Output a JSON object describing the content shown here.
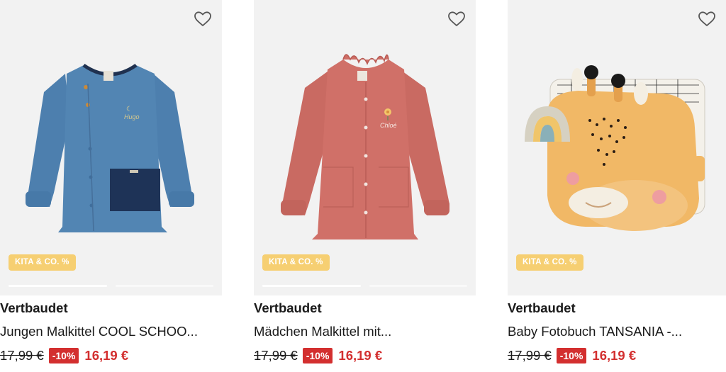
{
  "colors": {
    "badge": "#f6cf72",
    "discount": "#d32f2f",
    "price_new": "#d32f2f",
    "image_bg": "#f2f2f2"
  },
  "products": [
    {
      "badge": "KITA & CO. %",
      "brand": "Vertbaudet",
      "title": "Jungen Malkittel COOL SCHOO...",
      "price_old": "17,99 €",
      "discount": "-10%",
      "price_new": "16,19 €",
      "embroidery": "Hugo",
      "icon": "heart-outline-icon",
      "image_count": 2
    },
    {
      "badge": "KITA & CO. %",
      "brand": "Vertbaudet",
      "title": "Mädchen Malkittel mit...",
      "price_old": "17,99 €",
      "discount": "-10%",
      "price_new": "16,19 €",
      "embroidery": "Chloé",
      "icon": "heart-outline-icon",
      "image_count": 2
    },
    {
      "badge": "KITA & CO. %",
      "brand": "Vertbaudet",
      "title": "Baby Fotobuch TANSANIA -...",
      "price_old": "17,99 €",
      "discount": "-10%",
      "price_new": "16,19 €",
      "icon": "heart-outline-icon"
    }
  ]
}
